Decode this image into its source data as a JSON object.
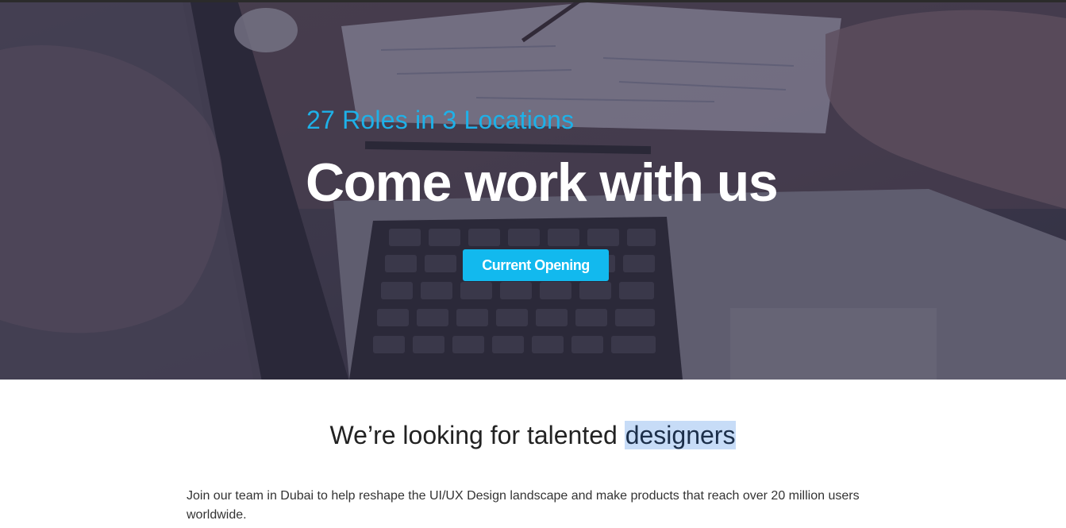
{
  "hero": {
    "subtitle": "27 Roles in 3 Locations",
    "title": "Come work with us",
    "cta_label": "Current Opening",
    "accent_color": "#1eb1e8",
    "button_color": "#12b9ee"
  },
  "section": {
    "title_prefix": "We’re looking for talented ",
    "title_highlight": "designers",
    "body": "Join our team in Dubai to help reshape the UI/UX Design landscape and make products that reach over 20 million users worldwide."
  }
}
